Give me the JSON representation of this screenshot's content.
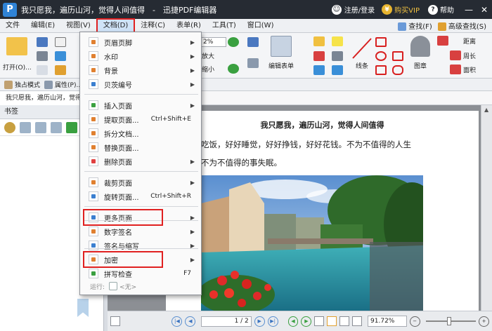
{
  "title_bar": {
    "app_logo": "P",
    "title": "我只愿我，遍历山河，觉得人间值得　-　迅捷PDF编辑器",
    "login": "注册/登录",
    "vip_badge": "¥",
    "buy_vip": "购买VIP",
    "help": "帮助",
    "minimize": "—",
    "close": "✕"
  },
  "menu_bar": {
    "items": [
      "文件",
      "编辑(E)",
      "视图(V)",
      "文档(D)",
      "注释(C)",
      "表单(R)",
      "工具(T)",
      "窗口(W)"
    ],
    "find": "查找(F)",
    "advanced_find": "高级查找(S)"
  },
  "ribbon": {
    "open": "打开(O)...",
    "zoom_value": "2%",
    "zoom_in": "放大",
    "zoom_out": "缩小",
    "edit_form": "编辑表单",
    "lines": "线条",
    "stamp": "图章",
    "distance": "距离",
    "perimeter": "周长",
    "area": "面积"
  },
  "quick_row": {
    "exclusive_mode": "独占模式",
    "properties": "属性(P)..."
  },
  "doc_tab": "我只愿我，遍历山河，觉得人间值得",
  "left_panel": {
    "header": "书签"
  },
  "document": {
    "title": "我只愿我，遍历山河，觉得人间值得",
    "line1": "吃饭，好好睡觉，好好挣钱，好好花钱。不为不值得的人生",
    "line2": "不为不值得的事失眠。"
  },
  "bottom_bar": {
    "page_value": "1 / 2",
    "zoom_value": "91.72%"
  },
  "dropdown": {
    "items": [
      {
        "label": "页眉页脚",
        "shortcut": "",
        "submenu": true,
        "color": "#e08030"
      },
      {
        "label": "水印",
        "shortcut": "",
        "submenu": true,
        "color": "#e08030"
      },
      {
        "label": "背景",
        "shortcut": "",
        "submenu": true,
        "color": "#e08030"
      },
      {
        "label": "贝茨编号",
        "shortcut": "",
        "submenu": true,
        "color": "#3a7fd0"
      },
      {
        "label": "插入页面",
        "shortcut": "",
        "submenu": true,
        "color": "#3aa040"
      },
      {
        "label": "提取页面...",
        "shortcut": "Ctrl+Shift+E",
        "submenu": false,
        "color": "#e08030"
      },
      {
        "label": "拆分文档...",
        "shortcut": "",
        "submenu": false,
        "color": "#e08030"
      },
      {
        "label": "替换页面...",
        "shortcut": "",
        "submenu": false,
        "color": "#e08030"
      },
      {
        "label": "删除页面",
        "shortcut": "",
        "submenu": true,
        "color": "#e04040"
      },
      {
        "label": "裁剪页面",
        "shortcut": "",
        "submenu": true,
        "color": "#e08030"
      },
      {
        "label": "旋转页面...",
        "shortcut": "Ctrl+Shift+R",
        "submenu": false,
        "color": "#3a7fd0"
      },
      {
        "label": "更多页面",
        "shortcut": "",
        "submenu": true,
        "color": "#3a7fd0"
      },
      {
        "label": "数字签名",
        "shortcut": "",
        "submenu": true,
        "color": "#e08030"
      },
      {
        "label": "签名与缩写",
        "shortcut": "",
        "submenu": true,
        "color": "#3a7fd0"
      },
      {
        "label": "加密",
        "shortcut": "",
        "submenu": true,
        "color": "#e08030"
      },
      {
        "label": "拼写检查",
        "shortcut": "F7",
        "submenu": false,
        "color": "#3aa040"
      }
    ],
    "run_label": "运行:",
    "run_value": "<无>"
  }
}
